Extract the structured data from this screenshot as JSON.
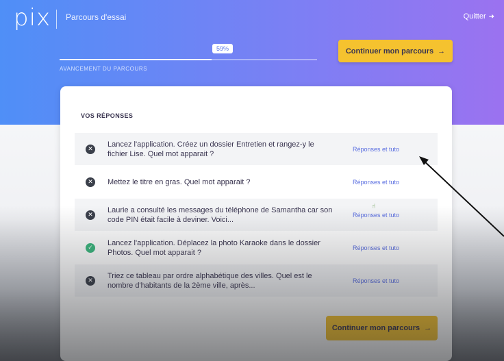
{
  "header": {
    "logo": "pix",
    "title": "Parcours d'essai",
    "quit_label": "Quitter",
    "quit_icon": "exit-icon"
  },
  "progress": {
    "percent": 59,
    "badge": "59%",
    "label": "Avancement du parcours"
  },
  "buttons": {
    "continue_label": "Continuer mon parcours",
    "continue_arrow": "→"
  },
  "card": {
    "title": "VOS RÉPONSES"
  },
  "answers": [
    {
      "status": "ko",
      "status_icon": "✕",
      "question": "Lancez l'application. Créez un dossier Entretien et rangez-y le fichier Lise. Quel mot apparait ?",
      "link": "Réponses et tuto",
      "shaded": true
    },
    {
      "status": "ko",
      "status_icon": "✕",
      "question": "Mettez le titre en gras. Quel mot apparait ?",
      "link": "Réponses et tuto",
      "shaded": false
    },
    {
      "status": "ko",
      "status_icon": "✕",
      "question": "Laurie a consulté les messages du téléphone de Samantha car son code PIN était facile à deviner. Voici...",
      "link": "Réponses et tuto",
      "shaded": true
    },
    {
      "status": "ok",
      "status_icon": "✓",
      "question": "Lancez l'application. Déplacez la photo Karaoke dans le dossier Photos. Quel mot apparait ?",
      "link": "Réponses et tuto",
      "shaded": false
    },
    {
      "status": "ko",
      "status_icon": "✕",
      "question": "Triez ce tableau par ordre alphabétique des villes. Quel est le nombre d'habitants de la 2ème ville, après...",
      "link": "Réponses et tuto",
      "shaded": true
    }
  ],
  "colors": {
    "accent": "#f5c22f",
    "link": "#5a6ee0",
    "ok": "#3bb77e",
    "ko": "#3a3f4a"
  }
}
